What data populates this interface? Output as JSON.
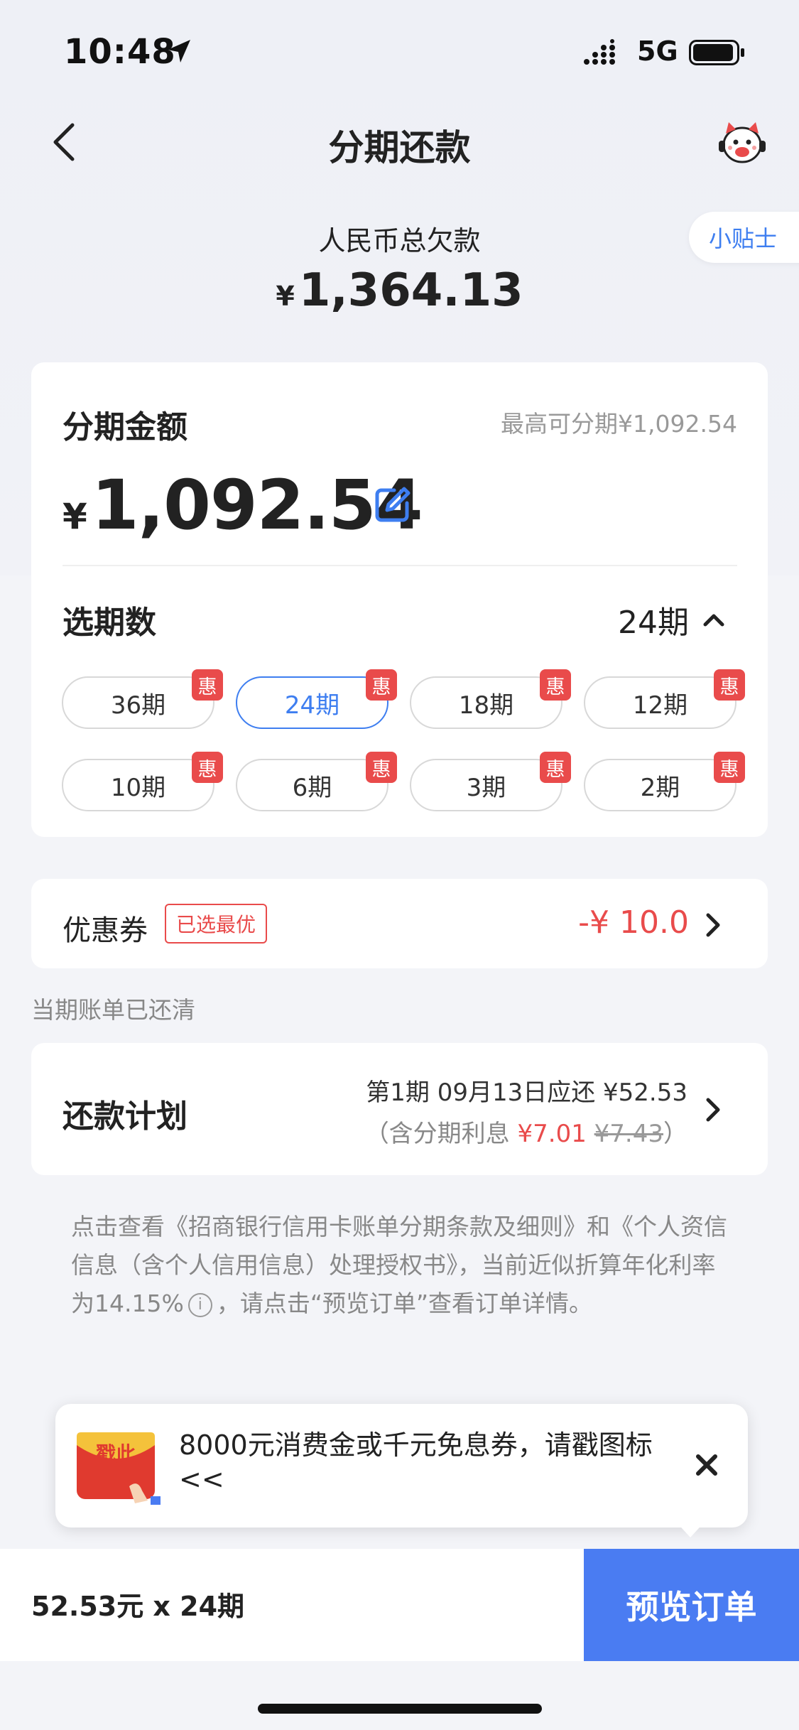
{
  "status_bar": {
    "time": "10:48",
    "network": "5G"
  },
  "nav": {
    "title": "分期还款"
  },
  "debt": {
    "label": "人民币总欠款",
    "currency": "¥",
    "amount": "1,364.13"
  },
  "tips": {
    "label": "小贴士"
  },
  "amount_card": {
    "title": "分期金额",
    "max_note": "最高可分期¥1,092.54",
    "currency": "¥",
    "amount": "1,092.54"
  },
  "period": {
    "title": "选期数",
    "selected": "24期",
    "badge": "惠",
    "options": [
      "36期",
      "24期",
      "18期",
      "12期",
      "10期",
      "6期",
      "3期",
      "2期"
    ],
    "selected_index": 1
  },
  "coupon": {
    "label": "优惠券",
    "tag": "已选最优",
    "value": "-¥ 10.0"
  },
  "cleared_note": "当期账单已还清",
  "plan": {
    "title": "还款计划",
    "line1": "第1期 09月13日应还 ¥52.53",
    "line2_prefix": "（含分期利息 ",
    "interest": "¥7.01",
    "original_interest": "¥7.43",
    "line2_suffix": "）"
  },
  "notice": {
    "part1": "点击查看《招商银行信用卡账单分期条款及细则》和《个人资信信息（含个人信用信息）处理授权书》，当前近似折算年化利率为14.15%",
    "info_glyph": "i",
    "part2": "，请点击“预览订单”查看订单详情。"
  },
  "promo": {
    "image_text": "戳此",
    "text": "8000元消费金或千元免息券，请戳图标<<"
  },
  "bottom": {
    "summary": "52.53元 x 24期",
    "preview_label": "预览订单"
  },
  "colors": {
    "accent": "#3e7ef0",
    "button": "#4a7cf2",
    "red": "#e94b4b"
  }
}
